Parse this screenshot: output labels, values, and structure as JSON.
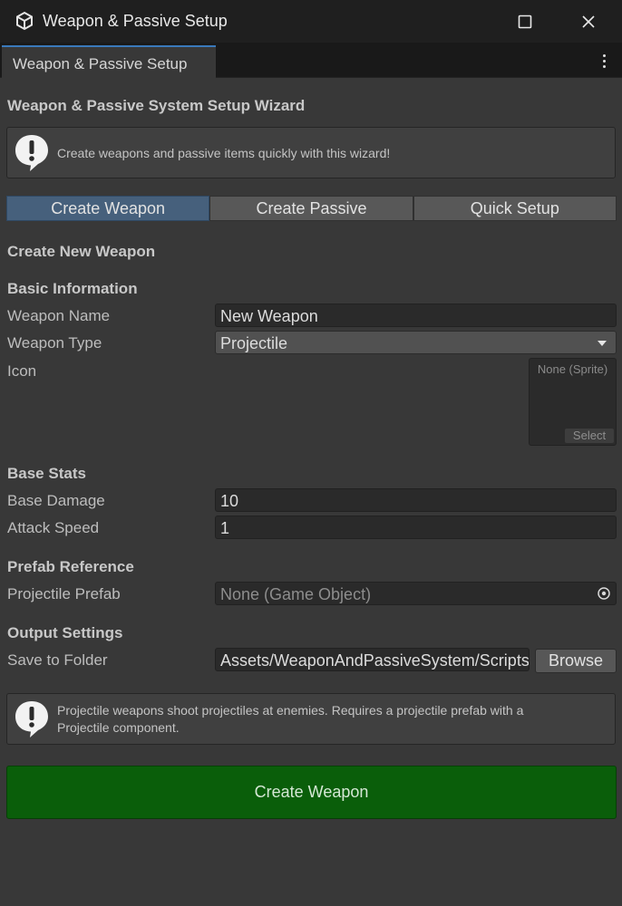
{
  "window": {
    "title": "Weapon & Passive Setup",
    "icon": "unity-cube-icon"
  },
  "tab": {
    "label": "Weapon & Passive Setup"
  },
  "header": {
    "title": "Weapon & Passive System Setup Wizard",
    "info": "Create weapons and passive items quickly with this wizard!"
  },
  "modes": [
    {
      "label": "Create Weapon",
      "active": true
    },
    {
      "label": "Create Passive",
      "active": false
    },
    {
      "label": "Quick Setup",
      "active": false
    }
  ],
  "form": {
    "section_title": "Create New Weapon",
    "basic": {
      "heading": "Basic Information",
      "name_label": "Weapon Name",
      "name_value": "New Weapon",
      "type_label": "Weapon Type",
      "type_value": "Projectile",
      "icon_label": "Icon",
      "icon_value": "None (Sprite)",
      "icon_select": "Select"
    },
    "stats": {
      "heading": "Base Stats",
      "damage_label": "Base Damage",
      "damage_value": "10",
      "speed_label": "Attack Speed",
      "speed_value": "1"
    },
    "prefab": {
      "heading": "Prefab Reference",
      "label": "Projectile Prefab",
      "value": "None (Game Object)"
    },
    "output": {
      "heading": "Output Settings",
      "label": "Save to Folder",
      "value": "Assets/WeaponAndPassiveSystem/Scripts",
      "browse": "Browse"
    }
  },
  "hint": {
    "line1": "Projectile weapons shoot projectiles at enemies. Requires a projectile prefab with a",
    "line2": "Projectile component."
  },
  "create_button": "Create Weapon",
  "colors": {
    "accent": "#46607c",
    "tab_highlight": "#3a79bb",
    "create_button": "#0a5e0a"
  }
}
